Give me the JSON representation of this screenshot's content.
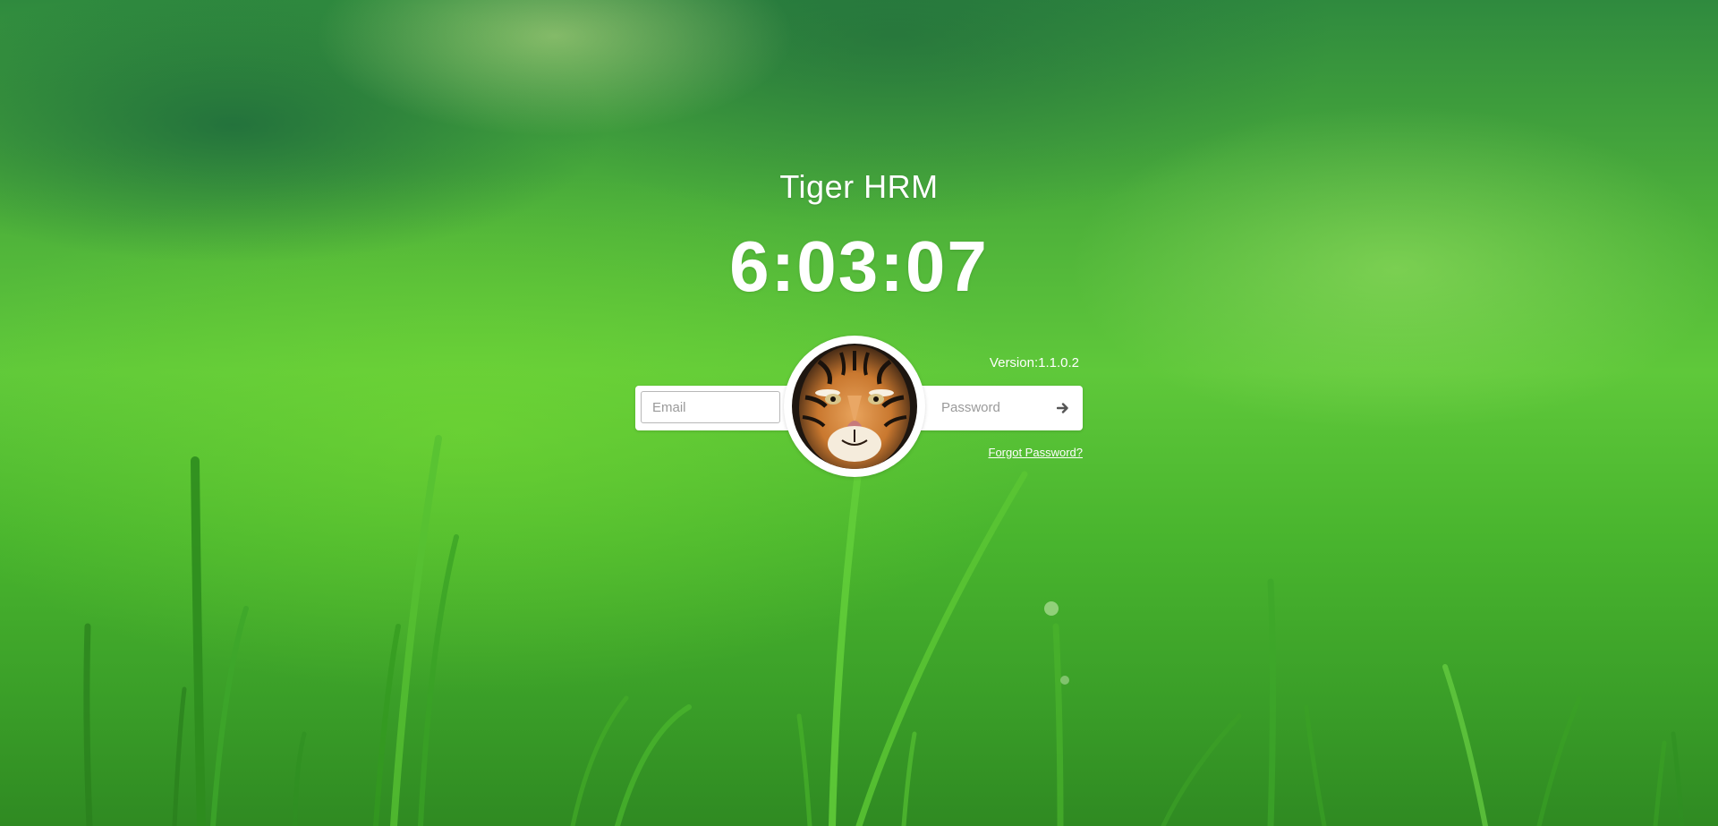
{
  "app": {
    "title": "Tiger HRM",
    "clock": "6:03:07",
    "version": "Version:1.1.0.2"
  },
  "login": {
    "email_placeholder": "Email",
    "email_value": "",
    "password_placeholder": "Password",
    "password_value": "",
    "submit_icon": "arrow-right-icon",
    "forgot_label": "Forgot Password?"
  },
  "avatar": {
    "icon": "tiger-face"
  },
  "colors": {
    "text": "#ffffff",
    "background_green": "#4fb33a",
    "panel": "#ffffff",
    "arrow": "#555555"
  }
}
